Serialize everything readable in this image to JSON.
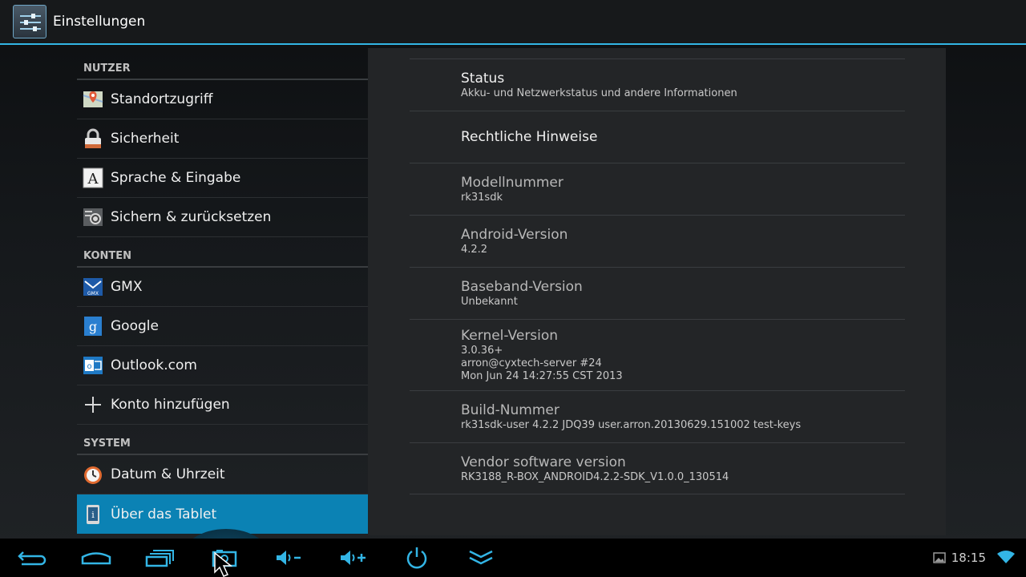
{
  "app": {
    "title": "Einstellungen"
  },
  "sections": [
    {
      "header": "NUTZER",
      "items": [
        {
          "label": "Standortzugriff",
          "icon": "location-map-icon"
        },
        {
          "label": "Sicherheit",
          "icon": "lock-icon"
        },
        {
          "label": "Sprache & Eingabe",
          "icon": "language-a-icon"
        },
        {
          "label": "Sichern & zurücksetzen",
          "icon": "backup-reset-icon"
        }
      ]
    },
    {
      "header": "KONTEN",
      "items": [
        {
          "label": "GMX",
          "icon": "gmx-mail-icon"
        },
        {
          "label": "Google",
          "icon": "google-icon"
        },
        {
          "label": "Outlook.com",
          "icon": "outlook-icon"
        },
        {
          "label": "Konto hinzufügen",
          "icon": "plus-icon"
        }
      ]
    },
    {
      "header": "SYSTEM",
      "items": [
        {
          "label": "Datum & Uhrzeit",
          "icon": "clock-icon"
        },
        {
          "label": "Über das Tablet",
          "icon": "tablet-info-icon",
          "selected": true
        }
      ]
    }
  ],
  "about": [
    {
      "title": "Status",
      "summary": "Akku- und Netzwerkstatus und andere Informationen",
      "clickable": true
    },
    {
      "title": "Rechtliche Hinweise",
      "summary": "",
      "clickable": true
    },
    {
      "title": "Modellnummer",
      "summary": "rk31sdk"
    },
    {
      "title": "Android-Version",
      "summary": "4.2.2"
    },
    {
      "title": "Baseband-Version",
      "summary": "Unbekannt"
    },
    {
      "title": "Kernel-Version",
      "summary_lines": [
        "3.0.36+",
        "arron@cyxtech-server #24",
        "Mon Jun 24 14:27:55 CST 2013"
      ]
    },
    {
      "title": "Build-Nummer",
      "summary": "rk31sdk-user 4.2.2 JDQ39 user.arron.20130629.151002 test-keys"
    },
    {
      "title": "Vendor software version",
      "summary": "RK3188_R-BOX_ANDROID4.2.2-SDK_V1.0.0_130514"
    }
  ],
  "navbar": {
    "buttons": [
      "back-icon",
      "home-icon",
      "recent-apps-icon",
      "screenshot-icon",
      "volume-down-icon",
      "volume-up-icon",
      "power-icon",
      "collapse-icon"
    ],
    "clock": "18:15"
  },
  "colors": {
    "accent": "#33b5e5",
    "selected": "#0b82b4"
  }
}
